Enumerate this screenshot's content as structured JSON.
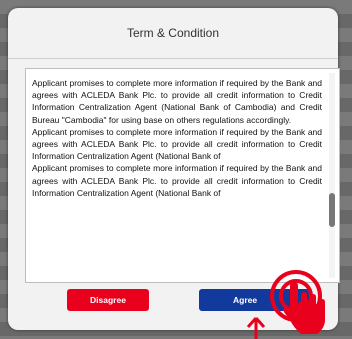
{
  "dialog": {
    "title": "Term & Condition",
    "terms_text": "Applicant promises to complete more information if required by the Bank and agrees with ACLEDA Bank Plc. to provide all credit information to Credit Information Centralization Agent (National Bank of Cambodia) and Credit Bureau \"Cambodia\" for using base on others regulations accordingly.\nApplicant promises to complete more information if required by the Bank and agrees with ACLEDA Bank Plc. to provide all credit information to Credit Information Centralization Agent (National Bank of\nApplicant promises to complete more information if required by the Bank and agrees with ACLEDA Bank Plc. to provide all credit information to Credit Information Centralization Agent (National Bank of",
    "disagree_label": "Disagree",
    "agree_label": "Agree"
  },
  "colors": {
    "disagree": "#e8001c",
    "agree": "#123a9c",
    "annotation": "#e8001c"
  },
  "icons": {
    "tap": "tap-gesture-icon",
    "arrow": "arrow-up-icon"
  }
}
